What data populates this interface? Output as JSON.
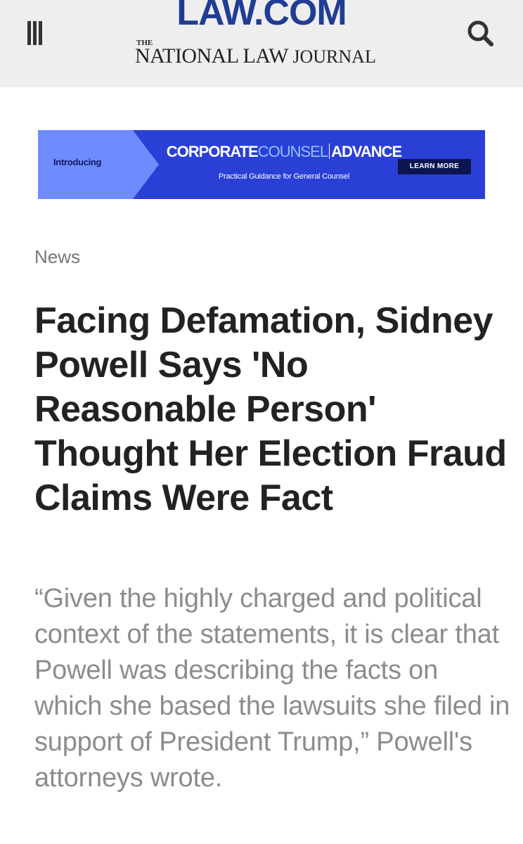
{
  "header": {
    "menu_icon": "hamburger-menu-icon",
    "search_icon": "search-icon",
    "brand": "LAW.COM",
    "publication_the": "THE",
    "publication_name_1": "NATIONAL LAW",
    "publication_name_2": "JOURNAL",
    "colors": {
      "background": "#eeeeee",
      "brand_blue": "#1f3d94"
    }
  },
  "ad": {
    "intro": "Introducing",
    "brand_part1": "CORPORATE",
    "brand_part2": "COUNSEL",
    "brand_part3": "ADVANCE",
    "tagline": "Practical Guidance for General Counsel",
    "cta": "LEARN MORE",
    "colors": {
      "background": "#2a3fd6",
      "arrow": "#6f8bff",
      "cta_background": "#0b1650"
    }
  },
  "article": {
    "category": "News",
    "headline": "Facing Defamation, Sidney Powell Says 'No Reasonable Person' Thought Her Election Fraud Claims Were Fact",
    "dek": "“Given the highly charged and political context of the statements, it is clear that Powell was describing the facts on which she based the lawsuits she filed in support of President Trump,” Powell's attorneys wrote."
  }
}
